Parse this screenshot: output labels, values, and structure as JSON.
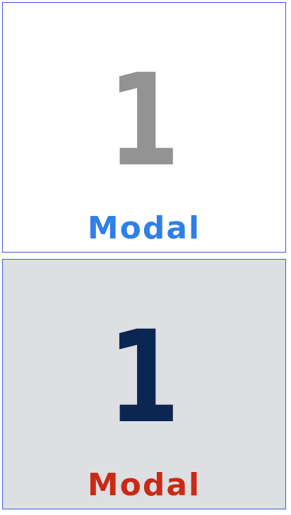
{
  "tiles": [
    {
      "number": "1",
      "label": "Modal",
      "colors": {
        "background": "#ffffff",
        "number": "#939393",
        "label": "#2f7fe8",
        "border": "#3b5bdb"
      }
    },
    {
      "number": "1",
      "label": "Modal",
      "colors": {
        "background": "#dedfe3",
        "number": "#0b2653",
        "label": "#c92a15",
        "border": "#3b5bdb"
      }
    }
  ]
}
